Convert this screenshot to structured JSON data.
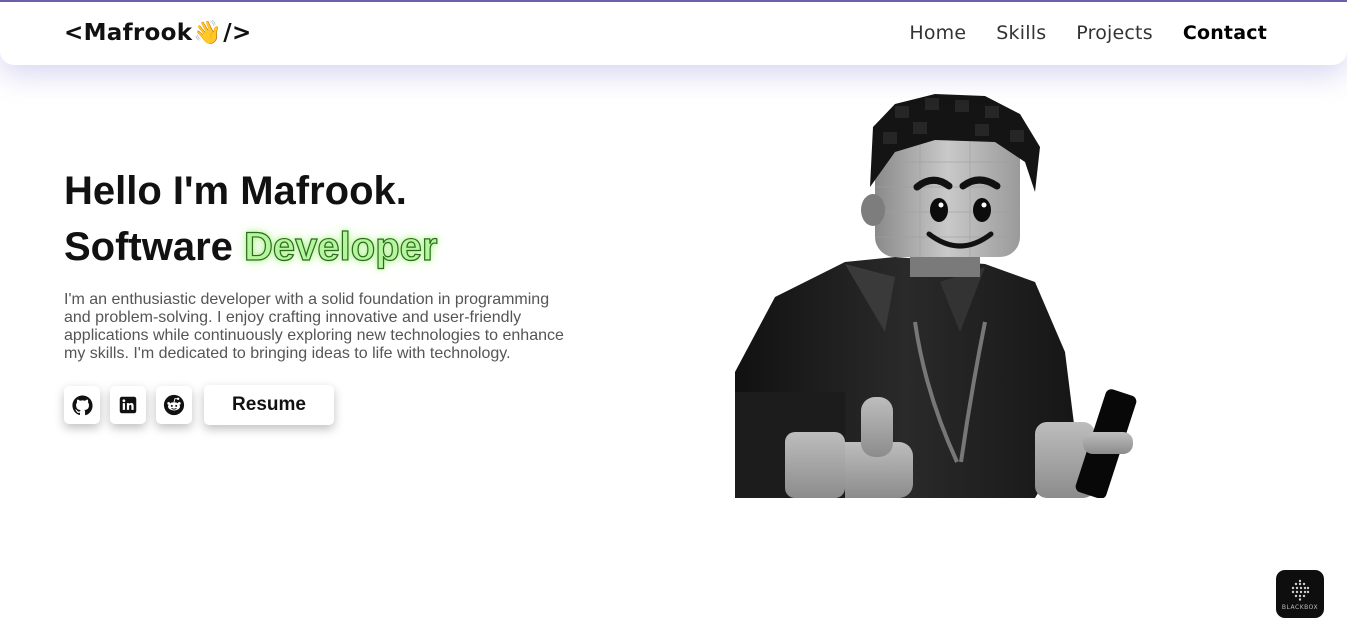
{
  "header": {
    "logo_prefix": "<Mafrook",
    "logo_emoji": "👋",
    "logo_suffix": "/>",
    "nav": [
      "Home",
      "Skills",
      "Projects",
      "Contact"
    ]
  },
  "hero": {
    "line1": "Hello I'm Mafrook.",
    "line2_prefix": "Software ",
    "line2_highlight": "Developer",
    "intro": "I'm an enthusiastic developer with a solid foundation in programming and problem-solving. I enjoy crafting innovative and user-friendly applications while continuously exploring new technologies to enhance my skills. I'm dedicated to bringing ideas to life with technology.",
    "social_icons": [
      "github-icon",
      "linkedin-icon",
      "reddit-icon"
    ],
    "resume_label": "Resume"
  },
  "widget": {
    "label": "BLACKBOX"
  },
  "colors": {
    "accent_glow": "#b6f5a0",
    "navbar_shadow": "#786ed2",
    "text": "#111111"
  }
}
